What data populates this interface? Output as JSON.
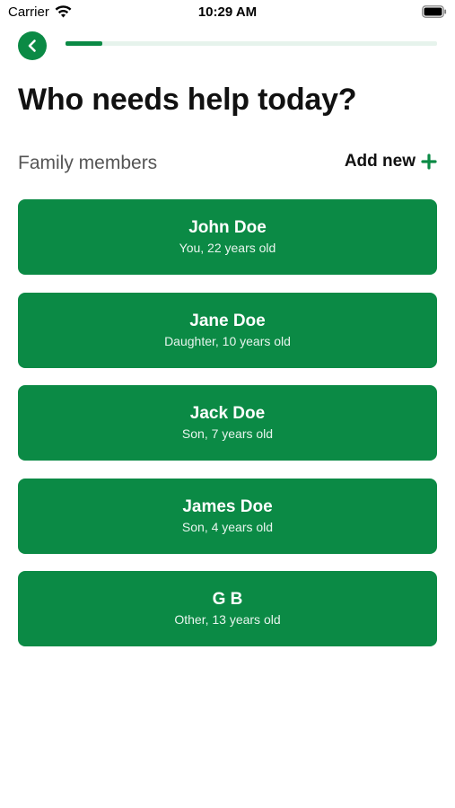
{
  "status_bar": {
    "carrier": "Carrier",
    "time": "10:29 AM"
  },
  "progress": {
    "value": 0.1,
    "color": "#0b8a45",
    "track_color": "#e6f3ec"
  },
  "page_title": "Who needs help today?",
  "section": {
    "label": "Family members",
    "add_new_label": "Add new"
  },
  "members": [
    {
      "name": "John Doe",
      "description": "You, 22 years old"
    },
    {
      "name": "Jane Doe",
      "description": "Daughter, 10 years old"
    },
    {
      "name": "Jack Doe",
      "description": "Son, 7 years old"
    },
    {
      "name": "James Doe",
      "description": "Son, 4 years old"
    },
    {
      "name": "G B",
      "description": "Other, 13 years old"
    }
  ],
  "icons": {
    "back": "chevron-left-icon",
    "add": "plus-icon",
    "wifi": "wifi-icon",
    "battery": "battery-icon"
  },
  "colors": {
    "brand_green": "#0b8a45"
  }
}
